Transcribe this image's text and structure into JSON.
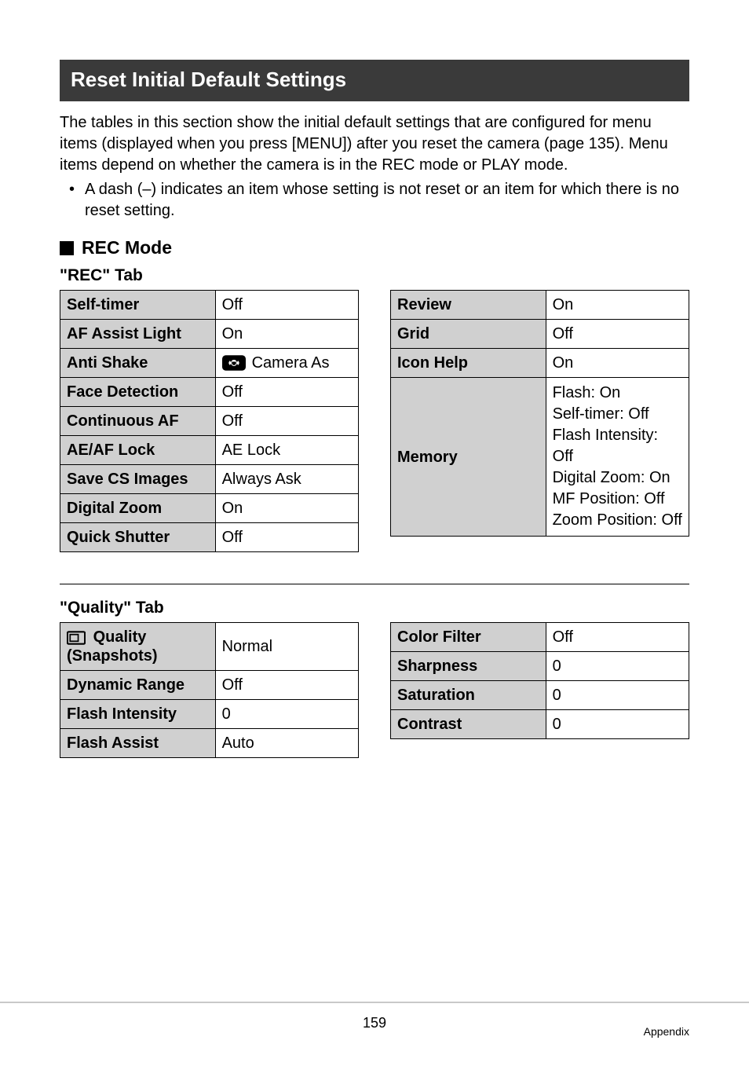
{
  "section_title": "Reset Initial Default Settings",
  "intro_para": "The tables in this section show the initial default settings that are configured for menu items (displayed when you press [MENU]) after you reset the camera (page 135). Menu items depend on whether the camera is in the REC mode or PLAY mode.",
  "note_bullet": "A dash (–) indicates an item whose setting is not reset or an item for which there is no reset setting.",
  "rec_mode_heading": "REC Mode",
  "rec_tab_title": "\"REC\" Tab",
  "rec": {
    "self_timer": {
      "label": "Self-timer",
      "value": "Off"
    },
    "af_assist_light": {
      "label": "AF Assist Light",
      "value": "On"
    },
    "anti_shake": {
      "label": "Anti Shake",
      "value": "Camera As"
    },
    "face_detection": {
      "label": "Face Detection",
      "value": "Off"
    },
    "continuous_af": {
      "label": "Continuous AF",
      "value": "Off"
    },
    "ae_af_lock": {
      "label": "AE/AF Lock",
      "value": "AE Lock"
    },
    "save_cs_images": {
      "label": "Save CS Images",
      "value": "Always Ask"
    },
    "digital_zoom": {
      "label": "Digital Zoom",
      "value": "On"
    },
    "quick_shutter": {
      "label": "Quick Shutter",
      "value": "Off"
    },
    "review": {
      "label": "Review",
      "value": "On"
    },
    "grid": {
      "label": "Grid",
      "value": "Off"
    },
    "icon_help": {
      "label": "Icon Help",
      "value": "On"
    },
    "memory": {
      "label": "Memory",
      "value": "Flash: On\nSelf-timer: Off\nFlash Intensity: Off\nDigital Zoom: On\nMF Position: Off\nZoom Position: Off"
    }
  },
  "quality_tab_title": "\"Quality\" Tab",
  "quality": {
    "quality_snapshots": {
      "label_line1": "Quality",
      "label_line2": "(Snapshots)",
      "value": "Normal"
    },
    "dynamic_range": {
      "label": "Dynamic Range",
      "value": "Off"
    },
    "flash_intensity": {
      "label": "Flash Intensity",
      "value": "0"
    },
    "flash_assist": {
      "label": "Flash Assist",
      "value": "Auto"
    },
    "color_filter": {
      "label": "Color Filter",
      "value": "Off"
    },
    "sharpness": {
      "label": "Sharpness",
      "value": "0"
    },
    "saturation": {
      "label": "Saturation",
      "value": "0"
    },
    "contrast": {
      "label": "Contrast",
      "value": "0"
    }
  },
  "footer": {
    "page": "159",
    "section": "Appendix"
  }
}
